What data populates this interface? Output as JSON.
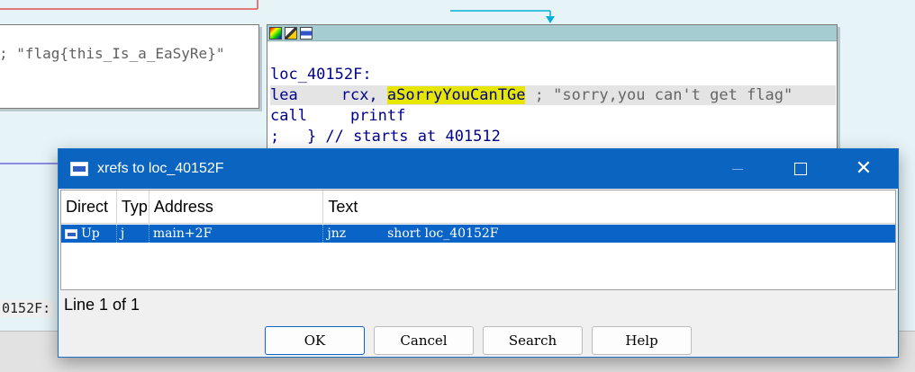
{
  "graph": {
    "left_node": {
      "comment": "; \"flag{this_Is_a_EaSyRe}\""
    },
    "right_node": {
      "label_line": "loc_40152F:",
      "lea": {
        "mnemonic": "lea",
        "operand1": "rcx, ",
        "operand2": "aSorryYouCanTGe",
        "comment": " ; \"sorry,you can't get flag\""
      },
      "call": {
        "mnemonic": "call",
        "operand": "printf"
      },
      "end_comment": ";   } // starts at 401512"
    },
    "address_fragment": "0152F:"
  },
  "dialog": {
    "title": "xrefs to loc_40152F",
    "columns": [
      "Direct",
      "Typ",
      "Address",
      "Text"
    ],
    "rows": [
      {
        "direction": "Up",
        "type": "j",
        "address": "main+2F",
        "text_mnemonic": "jnz",
        "text_operand": "short loc_40152F"
      }
    ],
    "status": "Line 1 of 1",
    "buttons": {
      "ok": "OK",
      "cancel": "Cancel",
      "search": "Search",
      "help": "Help"
    }
  },
  "colors": {
    "titlebar": "#0a64c0",
    "selection": "#0a64c8",
    "highlight": "#e6e600",
    "node_header": "#a5cdd1"
  }
}
